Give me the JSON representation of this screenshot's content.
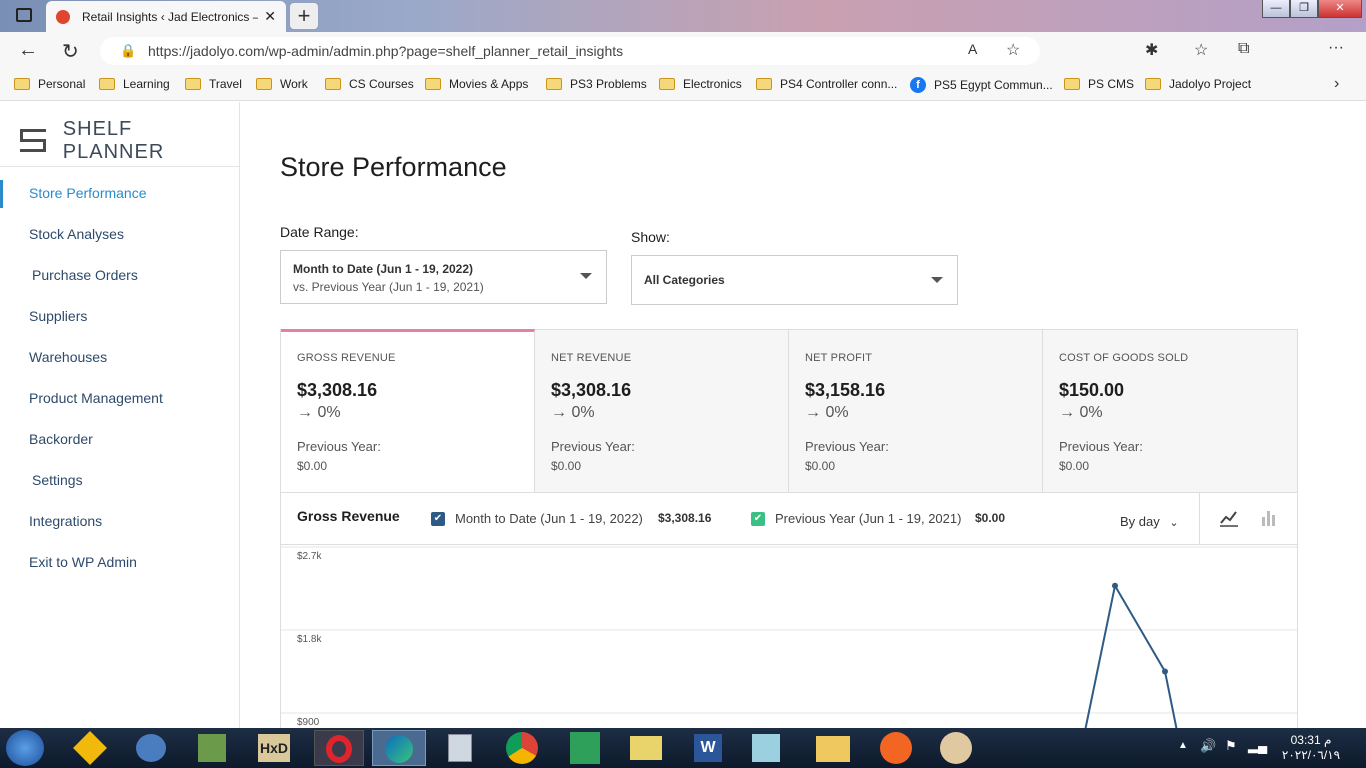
{
  "browser": {
    "tab_title": "Retail Insights ‹ Jad Electronics —",
    "url": "https://jadolyo.com/wp-admin/admin.php?page=shelf_planner_retail_insights",
    "bookmarks": [
      "Personal",
      "Learning",
      "Travel",
      "Work",
      "CS Courses",
      "Movies & Apps",
      "PS3 Problems",
      "Electronics",
      "PS4 Controller conn...",
      "PS5 Egypt Commun...",
      "PS CMS",
      "Jadolyo Project"
    ]
  },
  "sidebar": {
    "logo": "SHELF PLANNER",
    "items": [
      {
        "label": "Store Performance",
        "active": true
      },
      {
        "label": "Stock Analyses"
      },
      {
        "label": "Purchase Orders"
      },
      {
        "label": "Suppliers"
      },
      {
        "label": "Warehouses"
      },
      {
        "label": "Product Management"
      },
      {
        "label": "Backorder"
      },
      {
        "label": "Settings"
      },
      {
        "label": "Integrations"
      },
      {
        "label": "Exit to WP Admin"
      }
    ]
  },
  "main": {
    "title": "Store Performance",
    "date_range": {
      "label": "Date Range:",
      "value": "Month to Date (Jun 1 - 19, 2022)",
      "compare": "vs. Previous Year (Jun 1 - 19, 2021)"
    },
    "show": {
      "label": "Show:",
      "value": "All Categories"
    },
    "cards": [
      {
        "title": "GROSS REVENUE",
        "value": "$3,308.16",
        "delta": "→ 0%",
        "prev_label": "Previous Year:",
        "prev_value": "$0.00"
      },
      {
        "title": "NET REVENUE",
        "value": "$3,308.16",
        "delta": "→ 0%",
        "prev_label": "Previous Year:",
        "prev_value": "$0.00"
      },
      {
        "title": "NET PROFIT",
        "value": "$3,158.16",
        "delta": "→ 0%",
        "prev_label": "Previous Year:",
        "prev_value": "$0.00"
      },
      {
        "title": "COST OF GOODS SOLD",
        "value": "$150.00",
        "delta": "→ 0%",
        "prev_label": "Previous Year:",
        "prev_value": "$0.00"
      }
    ],
    "chart": {
      "title": "Gross Revenue",
      "legend": [
        {
          "label": "Month to Date (Jun 1 - 19, 2022)",
          "value": "$3,308.16",
          "color": "#2e5b85"
        },
        {
          "label": "Previous Year (Jun 1 - 19, 2021)",
          "value": "$0.00",
          "color": "#3bbf84"
        }
      ],
      "interval": "By day"
    }
  },
  "taskbar": {
    "time": "03:31 م",
    "date": "٢٠٢٢/٠٦/١٩"
  },
  "chart_data": {
    "type": "line",
    "title": "Gross Revenue",
    "y_ticks": [
      "$2.7k",
      "$1.8k",
      "$900"
    ],
    "series": [
      {
        "name": "Month to Date (Jun 1 - 19, 2022)",
        "values": [
          2280,
          1350
        ]
      }
    ]
  }
}
